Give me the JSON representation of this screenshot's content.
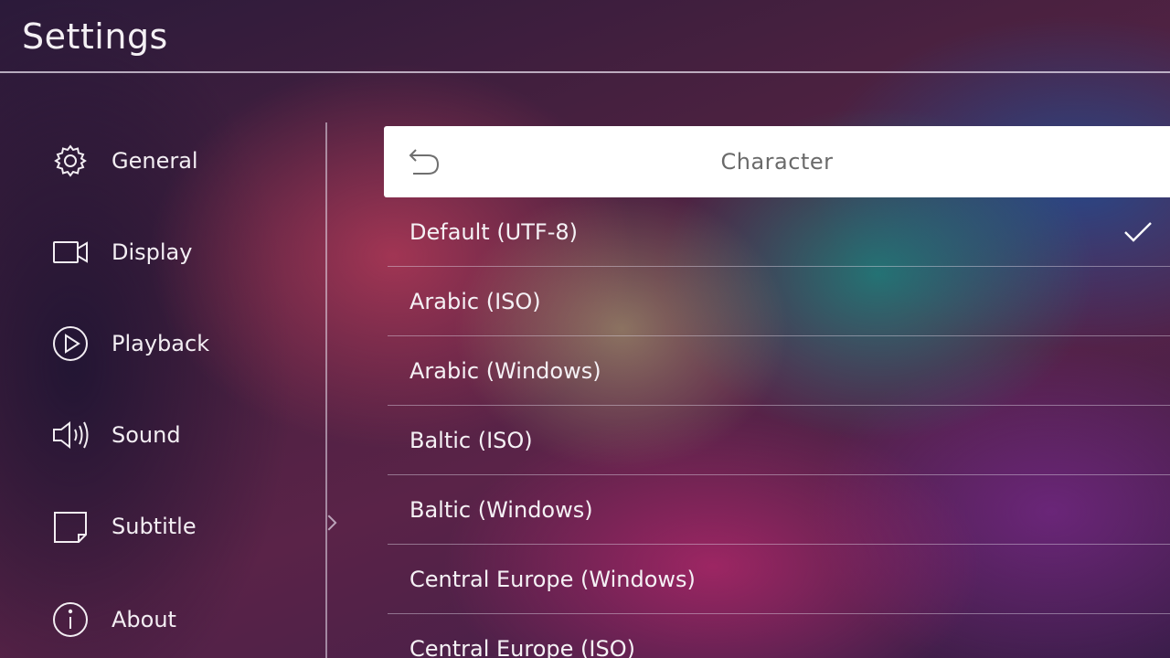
{
  "header": {
    "title": "Settings"
  },
  "sidebar": {
    "items": [
      {
        "label": "General",
        "icon": "gear-icon"
      },
      {
        "label": "Display",
        "icon": "camera-icon"
      },
      {
        "label": "Playback",
        "icon": "play-circle-icon"
      },
      {
        "label": "Sound",
        "icon": "speaker-icon"
      },
      {
        "label": "Subtitle",
        "icon": "subtitle-icon"
      },
      {
        "label": "About",
        "icon": "info-icon"
      }
    ],
    "active": "Subtitle"
  },
  "panel": {
    "title": "Character",
    "back_icon": "back-arrow-icon",
    "options": [
      {
        "label": "Default (UTF-8)",
        "selected": true
      },
      {
        "label": "Arabic (ISO)",
        "selected": false
      },
      {
        "label": "Arabic (Windows)",
        "selected": false
      },
      {
        "label": "Baltic (ISO)",
        "selected": false
      },
      {
        "label": "Baltic (Windows)",
        "selected": false
      },
      {
        "label": "Central Europe (Windows)",
        "selected": false
      },
      {
        "label": "Central Europe (ISO)",
        "selected": false
      }
    ]
  },
  "colors": {
    "header_bg": "#ffffff",
    "title_text": "#6a6a6a",
    "divider": "#e6dceb"
  }
}
